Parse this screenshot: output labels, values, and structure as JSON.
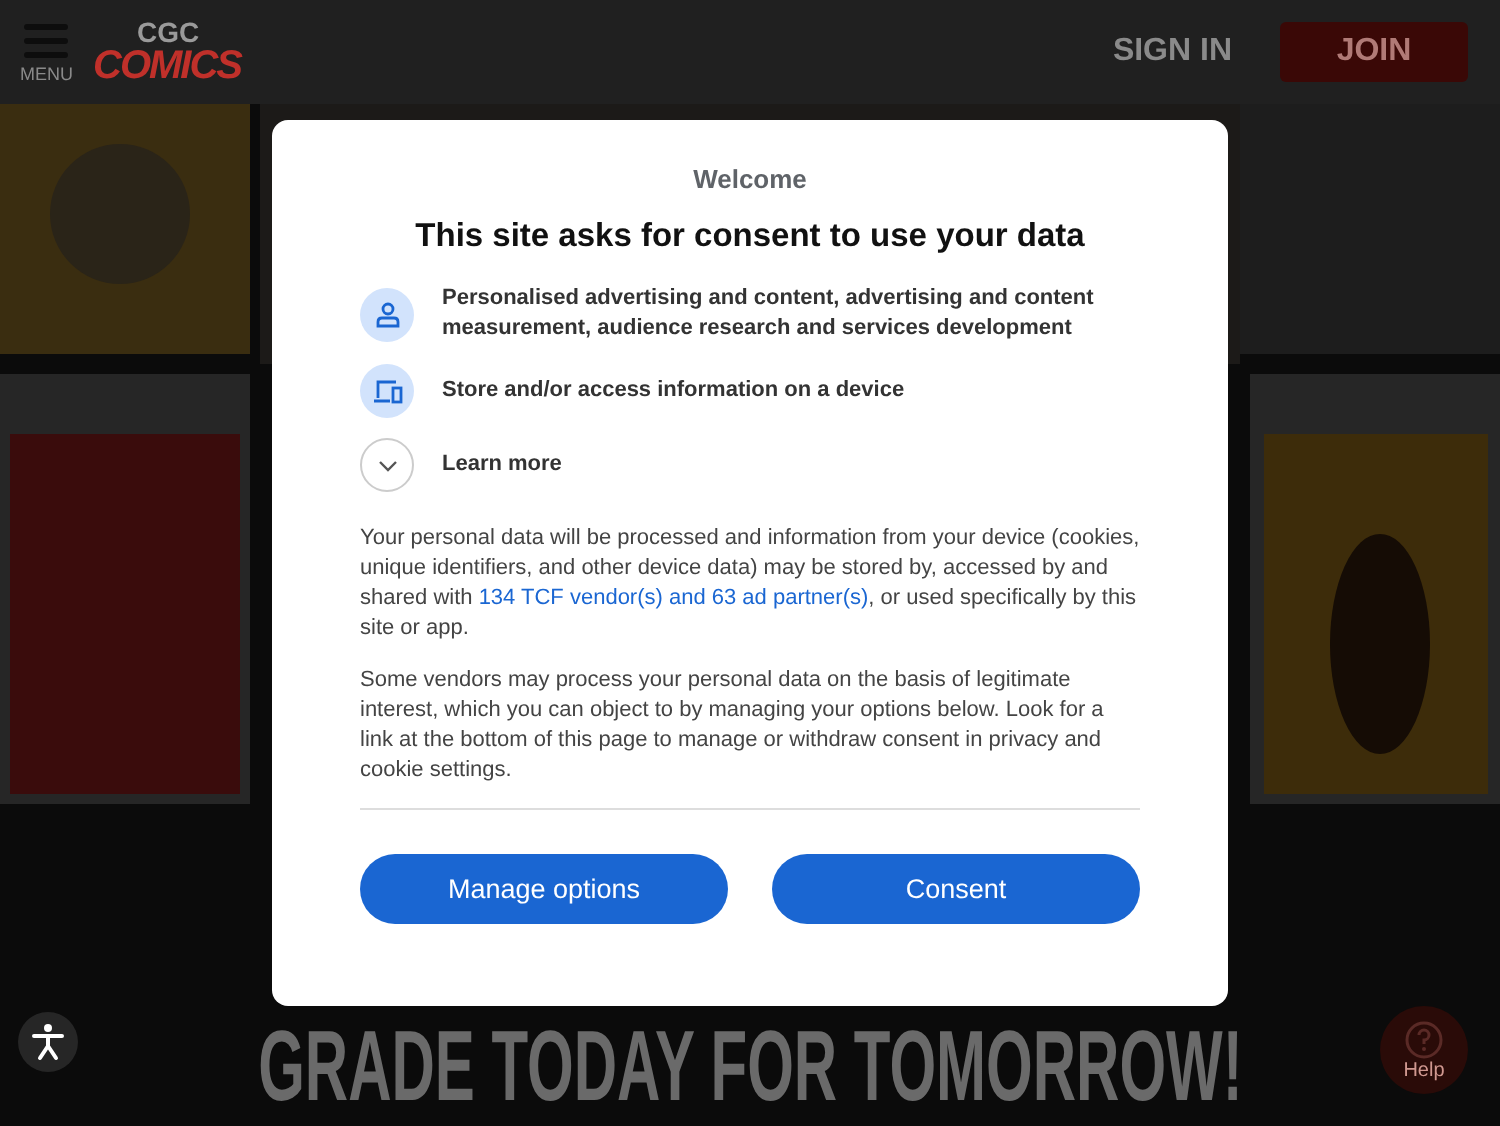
{
  "header": {
    "menu_label": "MENU",
    "logo_top": "CGC",
    "logo_bottom": "COMICS",
    "sign_in": "SIGN IN",
    "join": "JOIN"
  },
  "banner": {
    "text": "GRADE TODAY FOR TOMORROW!"
  },
  "help": {
    "label": "Help"
  },
  "dialog": {
    "eyebrow": "Welcome",
    "title": "This site asks for consent to use your data",
    "purposes": [
      {
        "kind": "person",
        "text": "Personalised advertising and content, advertising and content measurement, audience research and services development"
      },
      {
        "kind": "device",
        "text": "Store and/or access information on a device"
      }
    ],
    "learn_more": {
      "label": "Learn more",
      "expanded": false
    },
    "paragraph_1": {
      "before": "Your personal data will be processed and information from your device (cookies, unique identifiers, and other device data) may be stored by, accessed by and shared with ",
      "link": "134 TCF vendor(s) and 63 ad partner(s)",
      "after": ", or used specifically by this site or app."
    },
    "paragraph_2": "Some vendors may process your personal data on the basis of legitimate interest, which you can object to by managing your options below. Look for a link at the bottom of this page to manage or withdraw consent in privacy and cookie settings.",
    "buttons": [
      {
        "label": "Manage options"
      },
      {
        "label": "Consent"
      }
    ]
  }
}
